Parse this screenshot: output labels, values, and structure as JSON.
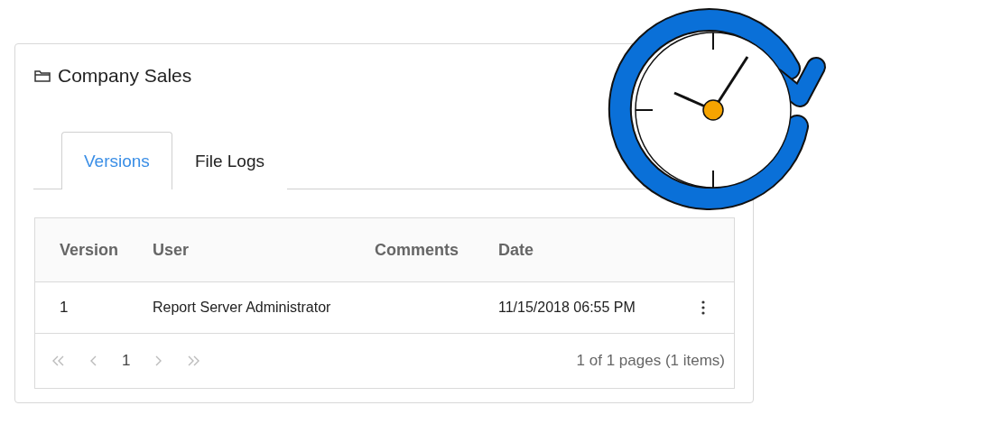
{
  "panel": {
    "title": "Company Sales"
  },
  "tabs": [
    {
      "label": "Versions",
      "selected": true
    },
    {
      "label": "File Logs",
      "selected": false
    }
  ],
  "table": {
    "columns": [
      "Version",
      "User",
      "Comments",
      "Date"
    ],
    "rows": [
      {
        "cells": [
          "1",
          "Report Server Administrator",
          "",
          "11/15/2018 06:55 PM"
        ],
        "has_menu": true
      }
    ]
  },
  "pager": {
    "buttons": [
      {
        "kind": "first",
        "disabled": true
      },
      {
        "kind": "prev",
        "disabled": true
      },
      {
        "kind": "page",
        "label": "1"
      },
      {
        "kind": "next",
        "disabled": true
      },
      {
        "kind": "last",
        "disabled": true
      }
    ],
    "summary": "1 of 1 pages (1 items)"
  }
}
